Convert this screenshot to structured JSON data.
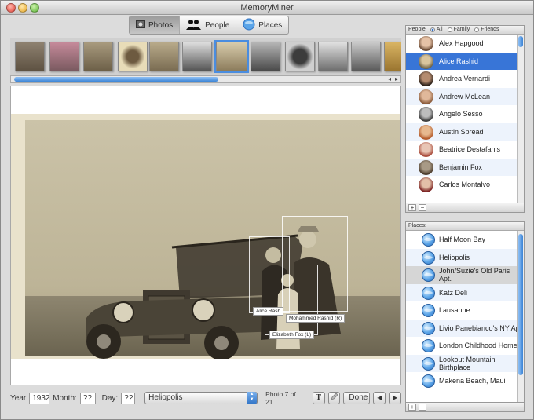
{
  "window": {
    "title": "MemoryMiner"
  },
  "tabs": [
    {
      "label": "Photos",
      "icon": "photo-icon",
      "active": true
    },
    {
      "label": "People",
      "icon": "people-icon",
      "active": false
    },
    {
      "label": "Places",
      "icon": "globe-icon",
      "active": false
    }
  ],
  "filmstrip": {
    "selected_index": 6,
    "thumb_count": 12
  },
  "photo": {
    "tags": [
      {
        "name": "Alice Rash"
      },
      {
        "name": "Mohammed Rashid (R)"
      },
      {
        "name": "Elizabeth Fox (L)"
      }
    ]
  },
  "bottom": {
    "year_label": "Year",
    "year_value": "1932",
    "month_label": "Month:",
    "month_value": "??",
    "day_label": "Day:",
    "day_value": "??",
    "place_value": "Heliopolis",
    "counter": "Photo 7 of 21",
    "text_button": "T",
    "done_button": "Done",
    "prev_symbol": "◀",
    "next_symbol": "▶"
  },
  "people_panel": {
    "header": "People",
    "filters": [
      {
        "label": "All",
        "on": true
      },
      {
        "label": "Family",
        "on": false
      },
      {
        "label": "Friends",
        "on": false
      }
    ],
    "items": [
      {
        "name": "Alex Hapgood",
        "selected": false
      },
      {
        "name": "Alice Rashid",
        "selected": true
      },
      {
        "name": "Andrea Vernardi",
        "selected": false
      },
      {
        "name": "Andrew McLean",
        "selected": false
      },
      {
        "name": "Angelo Sesso",
        "selected": false
      },
      {
        "name": "Austin Spread",
        "selected": false
      },
      {
        "name": "Beatrice Destafanis",
        "selected": false
      },
      {
        "name": "Benjamin Fox",
        "selected": false
      },
      {
        "name": "Carlos Montalvo",
        "selected": false
      }
    ],
    "add_symbol": "+",
    "remove_symbol": "−"
  },
  "places_panel": {
    "header": "Places:",
    "items": [
      {
        "name": "Half Moon Bay",
        "highlighted": false
      },
      {
        "name": "Heliopolis",
        "highlighted": false
      },
      {
        "name": "John/Suzie's Old Paris Apt.",
        "highlighted": true
      },
      {
        "name": "Katz Deli",
        "highlighted": false
      },
      {
        "name": "Lausanne",
        "highlighted": false
      },
      {
        "name": "Livio Panebianco's NY Apt.",
        "highlighted": false
      },
      {
        "name": "London Childhood Home",
        "highlighted": false
      },
      {
        "name": "Lookout Mountain Birthplace",
        "highlighted": false
      },
      {
        "name": "Makena Beach, Maui",
        "highlighted": false
      }
    ],
    "add_symbol": "+",
    "remove_symbol": "−"
  },
  "colors": {
    "selection": "#3875d7",
    "accent": "#3d85d6",
    "window": "#dcdcdc"
  }
}
